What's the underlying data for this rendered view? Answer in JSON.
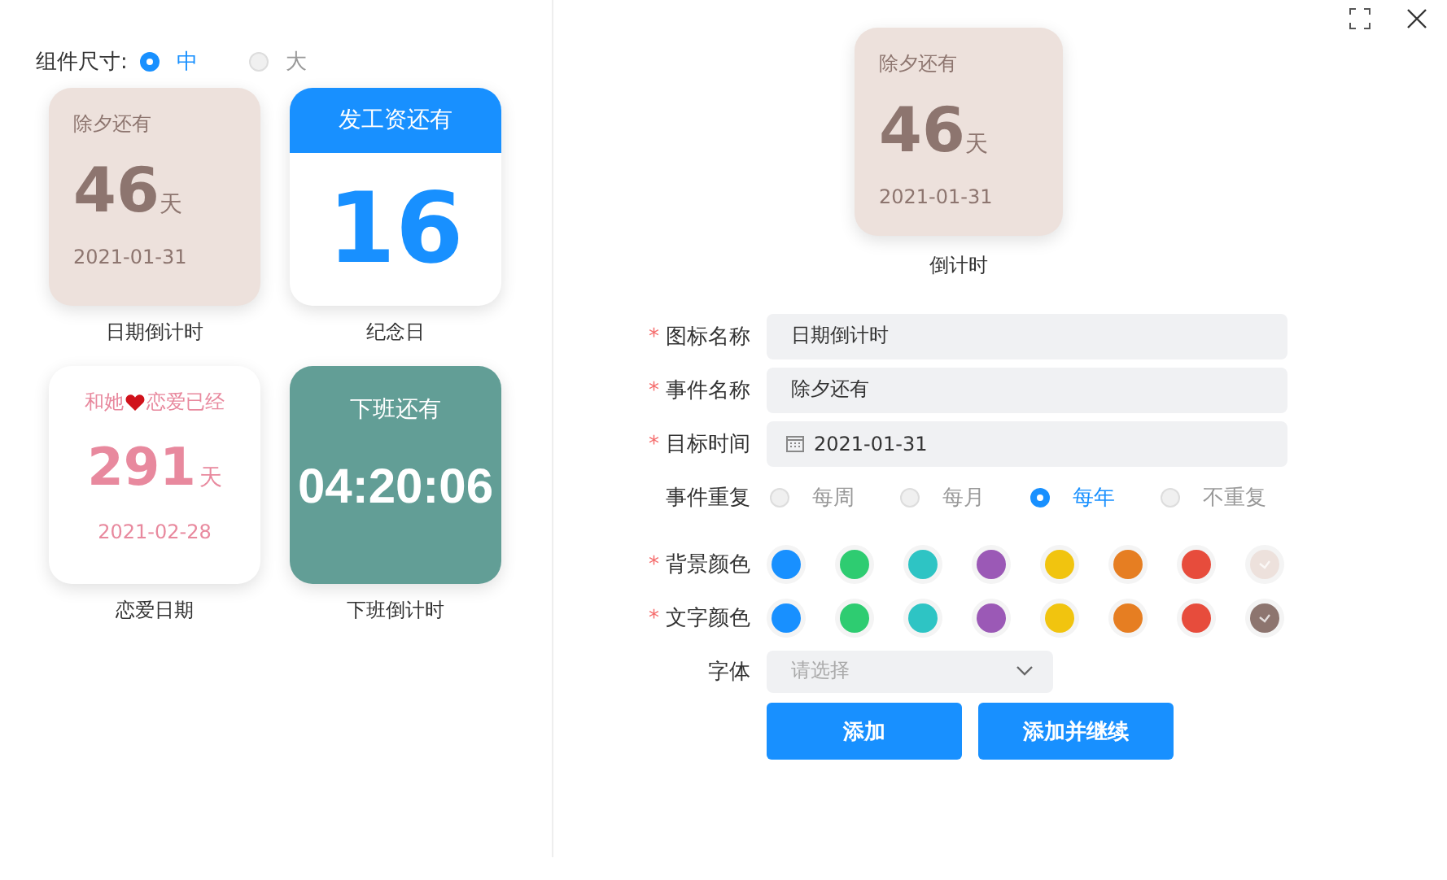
{
  "size_selector": {
    "label": "组件尺寸:",
    "options": [
      {
        "label": "中",
        "selected": true
      },
      {
        "label": "大",
        "selected": false
      }
    ]
  },
  "widgets": [
    {
      "kind": "countdown",
      "title": "除夕还有",
      "number": "46",
      "unit": "天",
      "date": "2021-01-31",
      "caption": "日期倒计时"
    },
    {
      "kind": "calendar",
      "title": "发工资还有",
      "number": "16",
      "caption": "纪念日"
    },
    {
      "kind": "love",
      "title_before": "和她",
      "title_after": "恋爱已经",
      "number": "291",
      "unit": "天",
      "date": "2021-02-28",
      "caption": "恋爱日期"
    },
    {
      "kind": "timer",
      "title": "下班还有",
      "number": "04:20:06",
      "caption": "下班倒计时"
    }
  ],
  "preview": {
    "title": "除夕还有",
    "number": "46",
    "unit": "天",
    "date": "2021-01-31",
    "caption": "倒计时"
  },
  "form": {
    "icon_name": {
      "label": "图标名称",
      "required_mark": "*",
      "value": "日期倒计时"
    },
    "event_name": {
      "label": "事件名称",
      "required_mark": "*",
      "value": "除夕还有"
    },
    "target_time": {
      "label": "目标时间",
      "required_mark": "*",
      "value": "2021-01-31"
    },
    "repeat": {
      "label": "事件重复",
      "options": [
        {
          "label": "每周",
          "selected": false
        },
        {
          "label": "每月",
          "selected": false
        },
        {
          "label": "每年",
          "selected": true
        },
        {
          "label": "不重复",
          "selected": false
        }
      ]
    },
    "background_color": {
      "label": "背景颜色",
      "required_mark": "*",
      "swatches": [
        {
          "color": "#1890ff",
          "selected": false
        },
        {
          "color": "#2ecc71",
          "selected": false
        },
        {
          "color": "#2ec4c4",
          "selected": false
        },
        {
          "color": "#9b59b6",
          "selected": false
        },
        {
          "color": "#f1c40f",
          "selected": false
        },
        {
          "color": "#e67e22",
          "selected": false
        },
        {
          "color": "#e74c3c",
          "selected": false
        },
        {
          "color": "#ede1dc",
          "selected": true
        }
      ]
    },
    "text_color": {
      "label": "文字颜色",
      "required_mark": "*",
      "swatches": [
        {
          "color": "#1890ff",
          "selected": false
        },
        {
          "color": "#2ecc71",
          "selected": false
        },
        {
          "color": "#2ec4c4",
          "selected": false
        },
        {
          "color": "#9b59b6",
          "selected": false
        },
        {
          "color": "#f1c40f",
          "selected": false
        },
        {
          "color": "#e67e22",
          "selected": false
        },
        {
          "color": "#e74c3c",
          "selected": false
        },
        {
          "color": "#8d756f",
          "selected": true
        }
      ]
    },
    "font": {
      "label": "字体",
      "placeholder": "请选择"
    },
    "buttons": [
      "添加",
      "添加并继续"
    ]
  }
}
